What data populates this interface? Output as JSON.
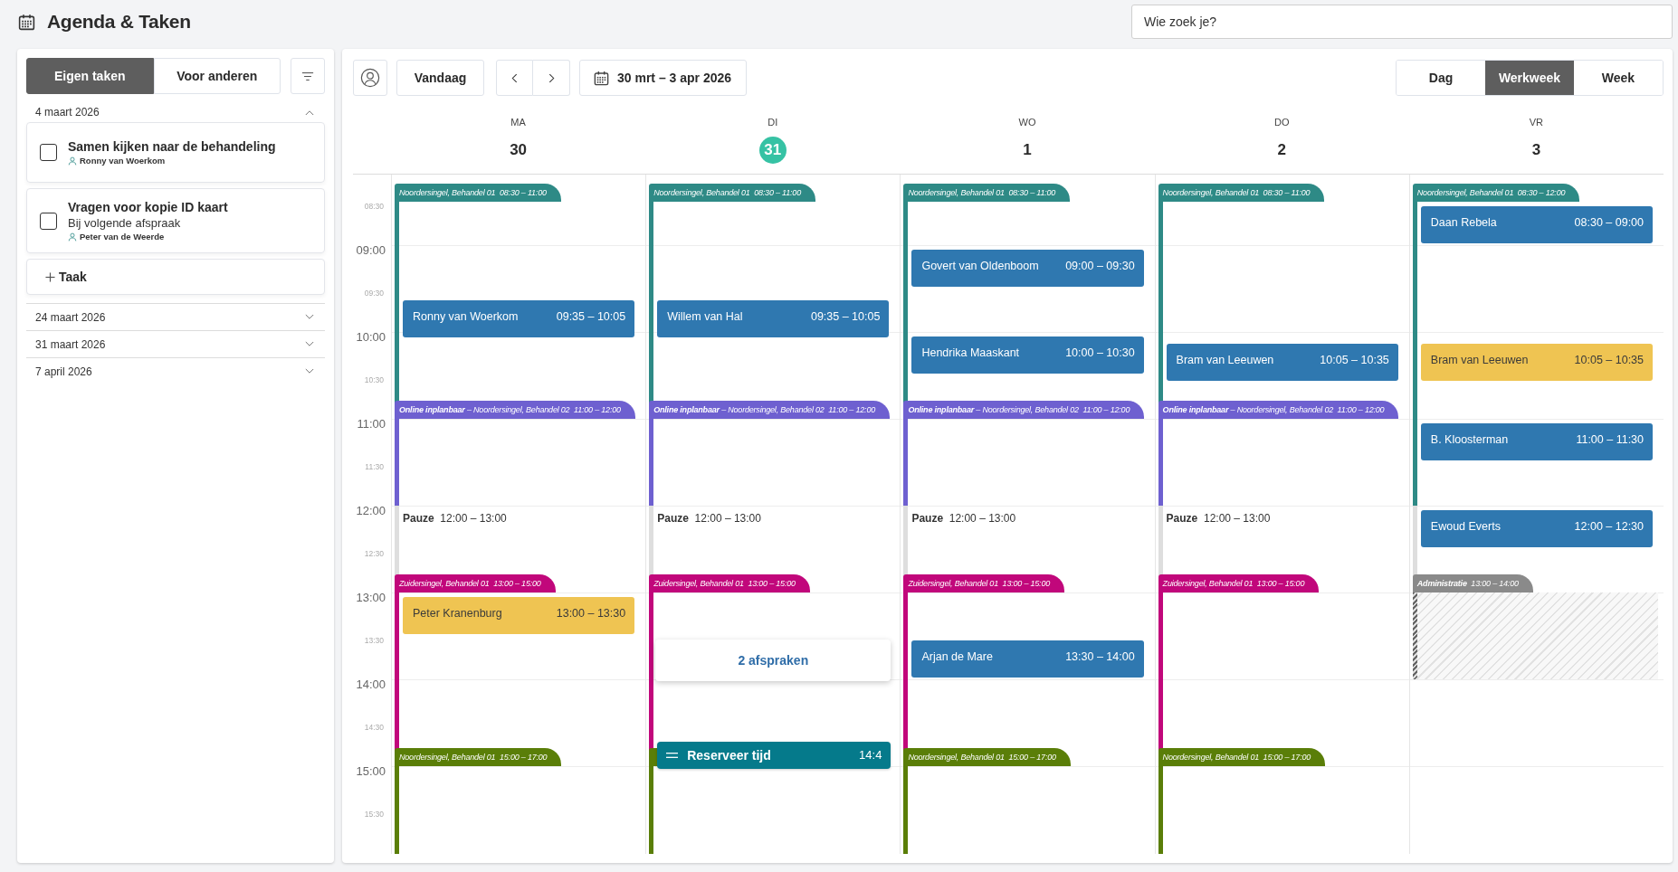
{
  "header": {
    "title": "Agenda & Taken",
    "search": {
      "placeholder": "Wie zoek je?"
    }
  },
  "tasks_panel": {
    "tabs": [
      {
        "label": "Eigen taken",
        "selected": true
      },
      {
        "label": "Voor anderen",
        "selected": false
      }
    ],
    "groups": [
      {
        "date": "4 maart 2026",
        "expanded": true,
        "tasks": [
          {
            "title": "Samen kijken naar de behandeling",
            "checked": false,
            "person": "Ronny van Woerkom"
          },
          {
            "title": "Vragen voor kopie ID kaart",
            "note": "Bij volgende afspraak",
            "checked": false,
            "person": "Peter van de Weerde"
          }
        ],
        "add_label": "Taak"
      },
      {
        "date": "24 maart 2026",
        "expanded": false
      },
      {
        "date": "31 maart 2026",
        "expanded": false
      },
      {
        "date": "7 april 2026",
        "expanded": false
      }
    ]
  },
  "calendar": {
    "toolbar": {
      "today_button": "Vandaag",
      "range": "30 mrt – 3 apr 2026",
      "views": [
        {
          "label": "Dag",
          "selected": false
        },
        {
          "label": "Werkweek",
          "selected": true
        },
        {
          "label": "Week",
          "selected": false
        }
      ]
    },
    "time_labels": [
      {
        "text": "08:30",
        "kind": "half"
      },
      {
        "text": "09:00",
        "kind": "hour"
      },
      {
        "text": "09:30",
        "kind": "half"
      },
      {
        "text": "10:00",
        "kind": "hour"
      },
      {
        "text": "10:30",
        "kind": "half"
      },
      {
        "text": "11:00",
        "kind": "hour"
      },
      {
        "text": "11:30",
        "kind": "half"
      },
      {
        "text": "12:00",
        "kind": "hour"
      },
      {
        "text": "12:30",
        "kind": "half"
      },
      {
        "text": "13:00",
        "kind": "hour"
      },
      {
        "text": "13:30",
        "kind": "half"
      },
      {
        "text": "14:00",
        "kind": "hour"
      },
      {
        "text": "14:30",
        "kind": "half"
      },
      {
        "text": "15:00",
        "kind": "hour"
      },
      {
        "text": "15:30",
        "kind": "half"
      }
    ],
    "days": [
      {
        "weekday": "MA",
        "date": "30",
        "today": false,
        "blocks": [
          {
            "kind": "room",
            "label": "Noordersingel, Behandel 01  08:30 – 11:00",
            "color": "#2e8a86"
          },
          {
            "kind": "room",
            "label": "**Online inplanbaar** – Noordersingel, Behandel 02  11:00 – 12:00",
            "color": "#6e60d0"
          },
          {
            "kind": "pause",
            "label": "**Pauze**  12:00 – 13:00"
          },
          {
            "kind": "room",
            "label": "Zuidersingel, Behandel 01  13:00 – 15:00",
            "color": "#c1077b"
          },
          {
            "kind": "room",
            "label": "Noordersingel, Behandel 01  15:00 – 17:00",
            "color": "#5a7e08"
          }
        ],
        "items": [
          {
            "kind": "appointment",
            "name": "Ronny van Woerkom",
            "time": "09:35 – 10:05",
            "color": "#2f78b0"
          },
          {
            "kind": "appointment",
            "name": "Peter Kranenburg",
            "time": "13:00 – 13:30",
            "color": "#efc452"
          }
        ]
      },
      {
        "weekday": "DI",
        "date": "31",
        "today": true,
        "blocks": [
          {
            "kind": "room",
            "label": "Noordersingel, Behandel 01  08:30 – 11:00",
            "color": "#2e8a86"
          },
          {
            "kind": "room",
            "label": "**Online inplanbaar** – Noordersingel, Behandel 02  11:00 – 12:00",
            "color": "#6e60d0"
          },
          {
            "kind": "pause",
            "label": "**Pauze**  12:00 – 13:00"
          },
          {
            "kind": "room",
            "label": "Zuidersingel, Behandel 01  13:00 – 15:00",
            "color": "#c1077b"
          },
          {
            "kind": "room",
            "color": "#5a7e08"
          }
        ],
        "items": [
          {
            "kind": "appointment",
            "name": "Willem van Hal",
            "time": "09:35 – 10:05",
            "color": "#2f78b0"
          },
          {
            "kind": "more",
            "title": "2 afspraken"
          },
          {
            "kind": "reserve",
            "title": "Reserveer tijd",
            "time": "14:4"
          }
        ]
      },
      {
        "weekday": "WO",
        "date": "1",
        "today": false,
        "blocks": [
          {
            "kind": "room",
            "label": "Noordersingel, Behandel 01  08:30 – 11:00",
            "color": "#2e8a86"
          },
          {
            "kind": "room",
            "label": "**Online inplanbaar** – Noordersingel, Behandel 02  11:00 – 12:00",
            "color": "#6e60d0"
          },
          {
            "kind": "pause",
            "label": "**Pauze**  12:00 – 13:00"
          },
          {
            "kind": "room",
            "label": "Zuidersingel, Behandel 01  13:00 – 15:00",
            "color": "#c1077b"
          },
          {
            "kind": "room",
            "label": "Noordersingel, Behandel 01  15:00 – 17:00",
            "color": "#5a7e08"
          }
        ],
        "items": [
          {
            "kind": "appointment",
            "name": "Govert van Oldenboom",
            "time": "09:00 – 09:30",
            "color": "#2f78b0"
          },
          {
            "kind": "appointment",
            "name": "Hendrika Maaskant",
            "time": "10:00 – 10:30",
            "color": "#2f78b0"
          },
          {
            "kind": "appointment",
            "name": "Arjan de Mare",
            "time": "13:30 – 14:00",
            "color": "#2f78b0"
          }
        ]
      },
      {
        "weekday": "DO",
        "date": "2",
        "today": false,
        "blocks": [
          {
            "kind": "room",
            "label": "Noordersingel, Behandel 01  08:30 – 11:00",
            "color": "#2e8a86"
          },
          {
            "kind": "room",
            "label": "**Online inplanbaar** – Noordersingel, Behandel 02  11:00 – 12:00",
            "color": "#6e60d0"
          },
          {
            "kind": "pause",
            "label": "**Pauze**  12:00 – 13:00"
          },
          {
            "kind": "room",
            "label": "Zuidersingel, Behandel 01  13:00 – 15:00",
            "color": "#c1077b"
          },
          {
            "kind": "room",
            "label": "Noordersingel, Behandel 01  15:00 – 17:00",
            "color": "#5a7e08"
          }
        ],
        "items": [
          {
            "kind": "appointment",
            "name": "Bram van Leeuwen",
            "time": "10:05 – 10:35",
            "color": "#2f78b0"
          }
        ]
      },
      {
        "weekday": "VR",
        "date": "3",
        "today": false,
        "blocks": [
          {
            "kind": "room",
            "label": "Noordersingel, Behandel 01  08:30 – 12:00",
            "color": "#2e8a86"
          },
          {
            "kind": "pause"
          },
          {
            "kind": "blocked",
            "label": "**Administratie**  13:00 – 14:00",
            "color": "#8a8a8a"
          }
        ],
        "items": [
          {
            "kind": "appointment",
            "name": "Daan Rebela",
            "time": "08:30 – 09:00",
            "color": "#2f78b0"
          },
          {
            "kind": "appointment",
            "name": "Bram van Leeuwen",
            "time": "10:05 – 10:35",
            "color": "#efc452"
          },
          {
            "kind": "appointment",
            "name": "B. Kloosterman",
            "time": "11:00 – 11:30",
            "color": "#2f78b0"
          },
          {
            "kind": "appointment",
            "name": "Ewoud Everts",
            "time": "12:00 – 12:30",
            "color": "#2f78b0"
          }
        ]
      }
    ]
  }
}
